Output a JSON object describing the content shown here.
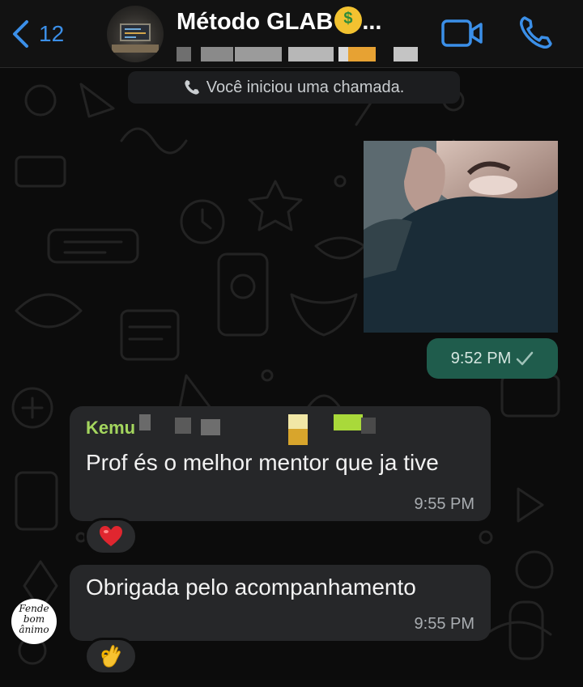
{
  "header": {
    "back_count": "12",
    "title": "Método GLAB",
    "title_emoji": "money-mouth-face",
    "title_suffix": "...",
    "accent_color": "#3b8fe8"
  },
  "system_message": {
    "text": "Você iniciou uma chamada.",
    "icon": "phone-icon"
  },
  "outgoing": {
    "time": "9:52 PM",
    "status_icon": "check-icon",
    "bubble_color": "#1f5c4c"
  },
  "incoming": [
    {
      "sender": "Kemu",
      "sender_color": "#a4d65e",
      "text": "Prof és o melhor mentor que ja tive",
      "time": "9:55 PM",
      "reaction": "red-heart"
    },
    {
      "text": "Obrigada pelo acompanhamento",
      "time": "9:55 PM",
      "reaction": "ok-hand"
    }
  ],
  "avatar_label": "Fende bom ânimo"
}
